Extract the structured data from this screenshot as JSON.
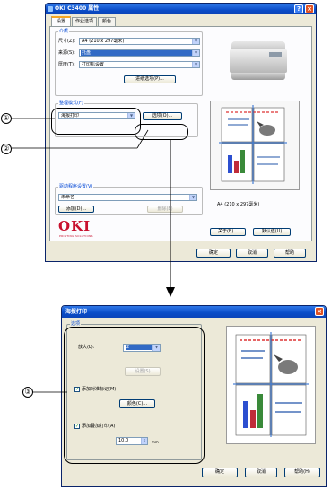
{
  "window1": {
    "title": "OKI C3400 属性",
    "tabs": [
      "设置",
      "作业选项",
      "颜色"
    ],
    "media_group": "介质",
    "size_label": "尺寸(Z):",
    "size_value": "A4 (210 x 297毫米)",
    "source_label": "来源(S):",
    "source_value": "托盘",
    "weight_label": "厚度(T):",
    "weight_value": "打印机设置",
    "paper_feed_button": "进纸选项(P)...",
    "finishing_label": "整理模式(F)",
    "finishing_value": "海报打印",
    "options_button": "选项(O)...",
    "driver_label": "驱动程序设置(V)",
    "driver_value": "未命名",
    "add_button": "添加(D)...",
    "delete_button": "删除(E)",
    "paper_caption": "A4 (210 x 297毫米)",
    "about_button": "关于(B)...",
    "default_button": "默认值(U)",
    "ok_button": "确定",
    "cancel_button": "取消",
    "help_button": "帮助",
    "logo": "OKI",
    "tagline": "PRINTING SOLUTIONS"
  },
  "window2": {
    "title": "海报打印",
    "options_group": "选项",
    "enlarge_label": "放大(L):",
    "enlarge_value": "2",
    "settings_button": "设置(S)",
    "add_marks_label": "添加对准标记(M)",
    "color_button": "颜色(C)...",
    "add_overlap_label": "添加叠加打印(A)",
    "overlap_value": "10.0",
    "overlap_unit": "mm",
    "ok_button": "确定",
    "cancel_button": "取消",
    "help_button": "帮助(H)"
  },
  "callouts": [
    "①",
    "②",
    "③"
  ],
  "colors": {
    "title_blue": "#0a4cc8",
    "window_bg": "#ece9d8",
    "selection": "#316ac5",
    "brand_red": "#c8102e"
  }
}
